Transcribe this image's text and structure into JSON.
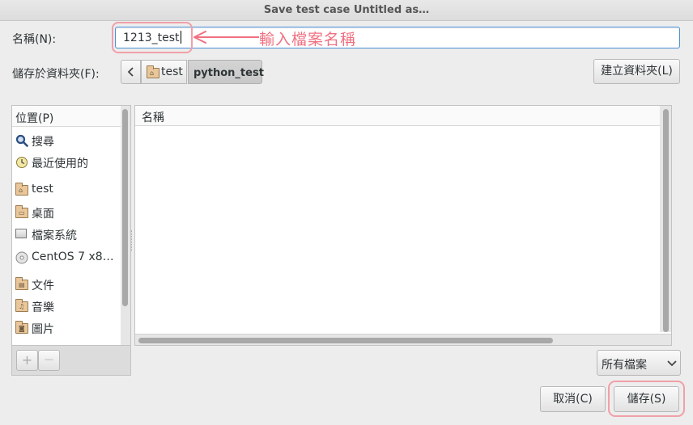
{
  "window": {
    "title": "Save test case Untitled as…"
  },
  "name_row": {
    "label": "名稱(N):",
    "value": "1213_test"
  },
  "annotation": {
    "text": "輸入檔案名稱",
    "color": "#f07080"
  },
  "folder_row": {
    "label": "儲存於資料夾(F):",
    "breadcrumbs": [
      "test",
      "python_test"
    ],
    "create_folder_label": "建立資料夾(L)"
  },
  "places": {
    "header": "位置(P)",
    "items": [
      {
        "label": "搜尋",
        "icon": "search-icon"
      },
      {
        "label": "最近使用的",
        "icon": "recent-icon"
      },
      {
        "label": "test",
        "icon": "home-folder-icon"
      },
      {
        "label": "桌面",
        "icon": "desktop-folder-icon"
      },
      {
        "label": "檔案系統",
        "icon": "drive-icon"
      },
      {
        "label": "CentOS 7 x8…",
        "icon": "disc-icon"
      },
      {
        "label": "文件",
        "icon": "documents-folder-icon"
      },
      {
        "label": "音樂",
        "icon": "music-folder-icon"
      },
      {
        "label": "圖片",
        "icon": "pictures-folder-icon"
      }
    ],
    "add_label": "+",
    "remove_label": "—"
  },
  "files": {
    "column_header": "名稱"
  },
  "filter": {
    "selected": "所有檔案"
  },
  "actions": {
    "cancel": "取消(C)",
    "save": "儲存(S)"
  },
  "colors": {
    "accent": "#4a90d9",
    "highlight": "#f0a0a8"
  }
}
